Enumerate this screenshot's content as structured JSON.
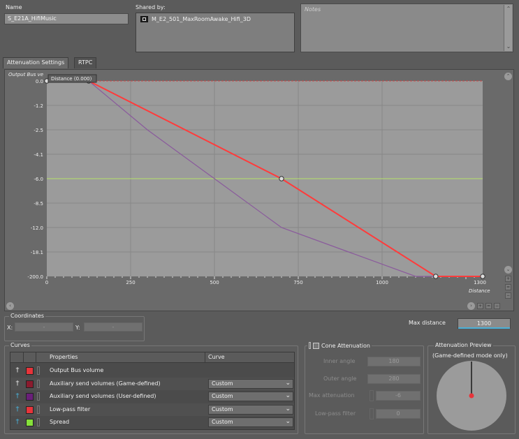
{
  "header": {
    "name_label": "Name",
    "name_value": "S_E21A_HifiMusic",
    "shared_label": "Shared by:",
    "shared_items": [
      "M_E2_501_MaxRoomAwake_Hifi_3D"
    ],
    "notes_placeholder": "Notes"
  },
  "tabs": [
    {
      "label": "Attenuation Settings",
      "active": true
    },
    {
      "label": "RTPC",
      "active": false
    }
  ],
  "graph": {
    "y_axis_title": "Output Bus ve",
    "tooltip": "Distance (0.000)",
    "x_axis_title": "Distance",
    "y_ticks": [
      "0.0",
      "-1.2",
      "-2.5",
      "-4.1",
      "-6.0",
      "-8.5",
      "-12.0",
      "-18.1",
      "-200.0"
    ],
    "x_ticks": [
      "0",
      "250",
      "500",
      "750",
      "1000",
      "1300"
    ],
    "colors": {
      "red_curve": "#ff3b3b",
      "purple_curve": "#8a5a9c",
      "green_line": "#b7e36a",
      "grid": "#878787",
      "bg": "#9b9b9b"
    }
  },
  "chart_data": {
    "type": "line",
    "xlabel": "Distance",
    "ylabel": "Output Bus ve",
    "xlim": [
      0,
      1300
    ],
    "series": [
      {
        "points": [
          [
            0,
            0.0
          ],
          [
            125,
            0.0
          ],
          [
            700,
            -6.0
          ],
          [
            1160,
            -200.0
          ],
          [
            1300,
            -200.0
          ]
        ]
      },
      {
        "points": [
          [
            125,
            0.0
          ],
          [
            300,
            -2.5
          ],
          [
            500,
            -6.0
          ],
          [
            700,
            -12.0
          ],
          [
            900,
            -18.1
          ],
          [
            1100,
            -200.0
          ],
          [
            1160,
            -200.0
          ]
        ]
      }
    ]
  },
  "coordinates": {
    "group_label": "Coordinates",
    "x_label": "X:",
    "x_value": "-",
    "y_label": "Y:",
    "y_value": "-"
  },
  "max_distance": {
    "label": "Max distance",
    "value": "1300"
  },
  "curves": {
    "group_label": "Curves",
    "col_properties": "Properties",
    "col_curve": "Curve",
    "rows": [
      {
        "name": "Output Bus volume",
        "curve": "",
        "color": "#e8343a",
        "pin": "#e6e6e6"
      },
      {
        "name": "Auxiliary send volumes (Game-defined)",
        "curve": "Custom",
        "color": "#8b1b2e",
        "pin": "#e6e6e6"
      },
      {
        "name": "Auxiliary send volumes (User-defined)",
        "curve": "Custom",
        "color": "#6a1f7a",
        "pin": "#4ab0d8"
      },
      {
        "name": "Low-pass filter",
        "curve": "Custom",
        "color": "#e8343a",
        "pin": "#4ab0d8"
      },
      {
        "name": "Spread",
        "curve": "Custom",
        "color": "#86e03a",
        "pin": "#4ab0d8"
      }
    ]
  },
  "cone": {
    "title": "Cone Attenuation",
    "inner_label": "Inner angle",
    "inner_value": "180",
    "outer_label": "Outer angle",
    "outer_value": "280",
    "max_att_label": "Max attenuation",
    "max_att_value": "-6",
    "lowpass_label": "Low-pass filter",
    "lowpass_value": "0"
  },
  "preview": {
    "title": "Attenuation Preview",
    "subtitle": "(Game-defined mode only)"
  }
}
